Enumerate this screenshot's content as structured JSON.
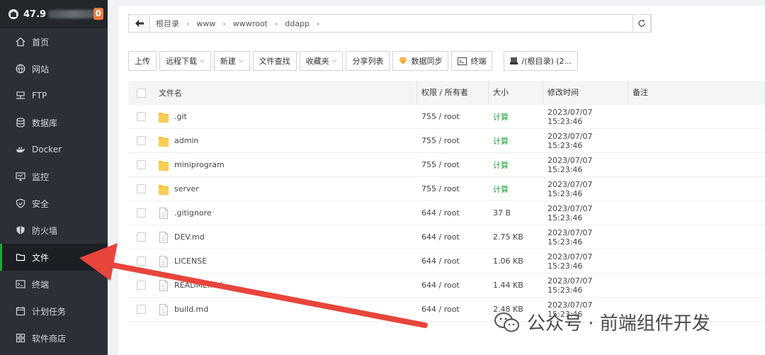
{
  "brand": {
    "ip_prefix": "47.9",
    "badge": "0"
  },
  "sidebar": {
    "items": [
      {
        "label": "首页",
        "icon": "home-icon"
      },
      {
        "label": "网站",
        "icon": "globe-icon"
      },
      {
        "label": "FTP",
        "icon": "ftp-icon"
      },
      {
        "label": "数据库",
        "icon": "database-icon"
      },
      {
        "label": "Docker",
        "icon": "docker-icon"
      },
      {
        "label": "监控",
        "icon": "monitor-icon"
      },
      {
        "label": "安全",
        "icon": "shield-icon"
      },
      {
        "label": "防火墙",
        "icon": "firewall-icon"
      },
      {
        "label": "文件",
        "icon": "folder-icon",
        "active": true
      },
      {
        "label": "终端",
        "icon": "terminal-icon"
      },
      {
        "label": "计划任务",
        "icon": "clock-icon"
      },
      {
        "label": "软件商店",
        "icon": "apps-icon"
      }
    ]
  },
  "path": {
    "crumbs": [
      "根目录",
      "www",
      "wwwroot",
      "ddapp"
    ]
  },
  "toolbar": {
    "upload": "上传",
    "remote_download": "远程下载",
    "new": "新建",
    "file_search": "文件查找",
    "favorites": "收藏夹",
    "share_list": "分享列表",
    "data_sync": "数据同步",
    "terminal": "终端",
    "disk": "/(根目录) (2..."
  },
  "table": {
    "headers": {
      "name": "文件名",
      "perm": "权限 / 所有者",
      "size": "大小",
      "time": "修改时间",
      "note": "备注"
    },
    "rows": [
      {
        "type": "folder",
        "name": ".git",
        "perm": "755 / root",
        "size": "计算",
        "time": "2023/07/07 15:23:46"
      },
      {
        "type": "folder",
        "name": "admin",
        "perm": "755 / root",
        "size": "计算",
        "time": "2023/07/07 15:23:46"
      },
      {
        "type": "folder",
        "name": "miniprogram",
        "perm": "755 / root",
        "size": "计算",
        "time": "2023/07/07 15:23:46"
      },
      {
        "type": "folder",
        "name": "server",
        "perm": "755 / root",
        "size": "计算",
        "time": "2023/07/07 15:23:46"
      },
      {
        "type": "file",
        "name": ".gitignore",
        "perm": "644 / root",
        "size": "37 B",
        "time": "2023/07/07 15:23:46"
      },
      {
        "type": "file",
        "name": "DEV.md",
        "perm": "644 / root",
        "size": "2.75 KB",
        "time": "2023/07/07 15:23:46"
      },
      {
        "type": "file",
        "name": "LICENSE",
        "perm": "644 / root",
        "size": "1.06 KB",
        "time": "2023/07/07 15:23:46"
      },
      {
        "type": "file",
        "name": "README.md",
        "perm": "644 / root",
        "size": "1.44 KB",
        "time": "2023/07/07 15:23:46"
      },
      {
        "type": "file",
        "name": "build.md",
        "perm": "644 / root",
        "size": "2.48 KB",
        "time": "2023/07/07 15:23:46"
      }
    ]
  },
  "watermark": {
    "text": "公众号 · 前端组件开发"
  },
  "colors": {
    "sidebar_bg": "#2c3036",
    "accent_green": "#20a53a",
    "badge_orange": "#f0783c",
    "arrow_red": "#e8453c",
    "folder_yellow": "#f5c242"
  }
}
